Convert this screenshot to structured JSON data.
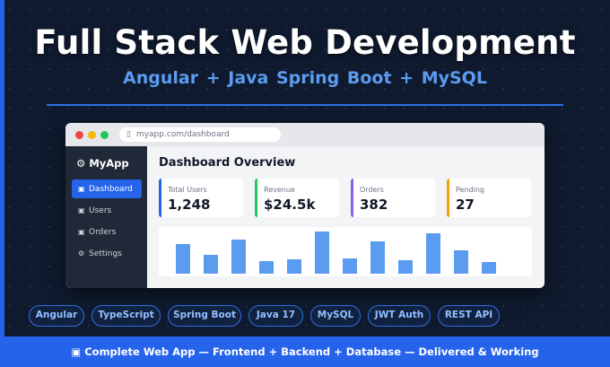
{
  "hero": {
    "title": "Full Stack Web Development",
    "subtitle": "Angular  +  Java Spring Boot  +  MySQL"
  },
  "browser": {
    "url": "myapp.com/dashboard",
    "url_icon": "lock-icon",
    "sidebar": {
      "brand": "⚙ MyApp",
      "items": [
        {
          "icon": "▣",
          "label": "Dashboard",
          "active": true
        },
        {
          "icon": "▣",
          "label": "Users"
        },
        {
          "icon": "▣",
          "label": "Orders"
        },
        {
          "icon": "⚙",
          "label": "Settings"
        }
      ]
    },
    "main": {
      "title": "Dashboard Overview",
      "cards": [
        {
          "label": "Total Users",
          "value": "1,248",
          "accent": "#2563eb"
        },
        {
          "label": "Revenue",
          "value": "$24.5k",
          "accent": "#22c55e"
        },
        {
          "label": "Orders",
          "value": "382",
          "accent": "#8b5cf6"
        },
        {
          "label": "Pending",
          "value": "27",
          "accent": "#f59e0b"
        }
      ],
      "chart_values": [
        32,
        21,
        37,
        14,
        16,
        46,
        17,
        35,
        15,
        44,
        25,
        13
      ]
    }
  },
  "tags": [
    "Angular",
    "TypeScript",
    "Spring Boot",
    "Java 17",
    "MySQL",
    "JWT Auth",
    "REST API"
  ],
  "footer": {
    "text": "▣ Complete Web App  —  Frontend + Backend + Database  —  Delivered & Working"
  },
  "colors": {
    "accent": "#2563eb",
    "subtitle": "#5b9cf0",
    "background": "#0f1a2e"
  }
}
